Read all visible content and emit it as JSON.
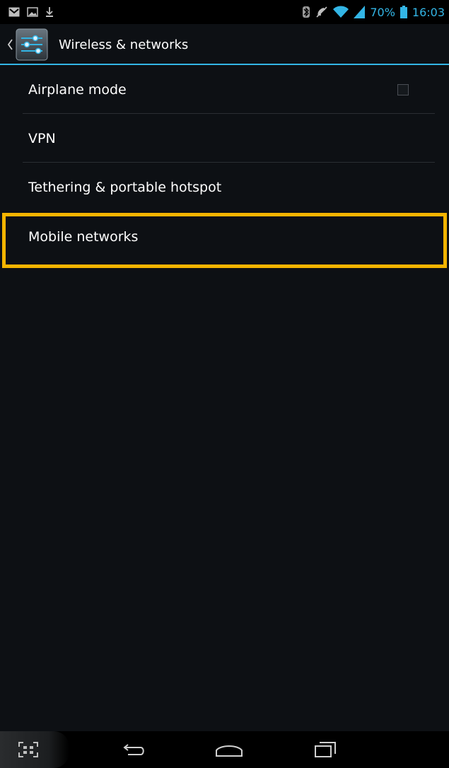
{
  "status_bar": {
    "left_icons": [
      "gmail-icon",
      "image-icon",
      "download-icon"
    ],
    "right_icons": [
      "bluetooth-icon",
      "mute-icon",
      "wifi-icon",
      "signal-icon",
      "battery-icon"
    ],
    "battery_percent": "70%",
    "time": "16:03",
    "accent_color": "#33b5e5"
  },
  "action_bar": {
    "title": "Wireless & networks",
    "icon": "settings-sliders-icon",
    "up_icon": "up-caret-icon"
  },
  "preferences": [
    {
      "label": "Airplane mode",
      "has_checkbox": true,
      "checked": false
    },
    {
      "label": "VPN"
    },
    {
      "label": "Tethering & portable hotspot"
    },
    {
      "label": "Mobile networks",
      "highlighted": true
    }
  ],
  "highlight_color": "#f5b400",
  "nav_bar": {
    "buttons": [
      "screenshot-icon",
      "back-icon",
      "home-icon",
      "recent-apps-icon"
    ]
  }
}
